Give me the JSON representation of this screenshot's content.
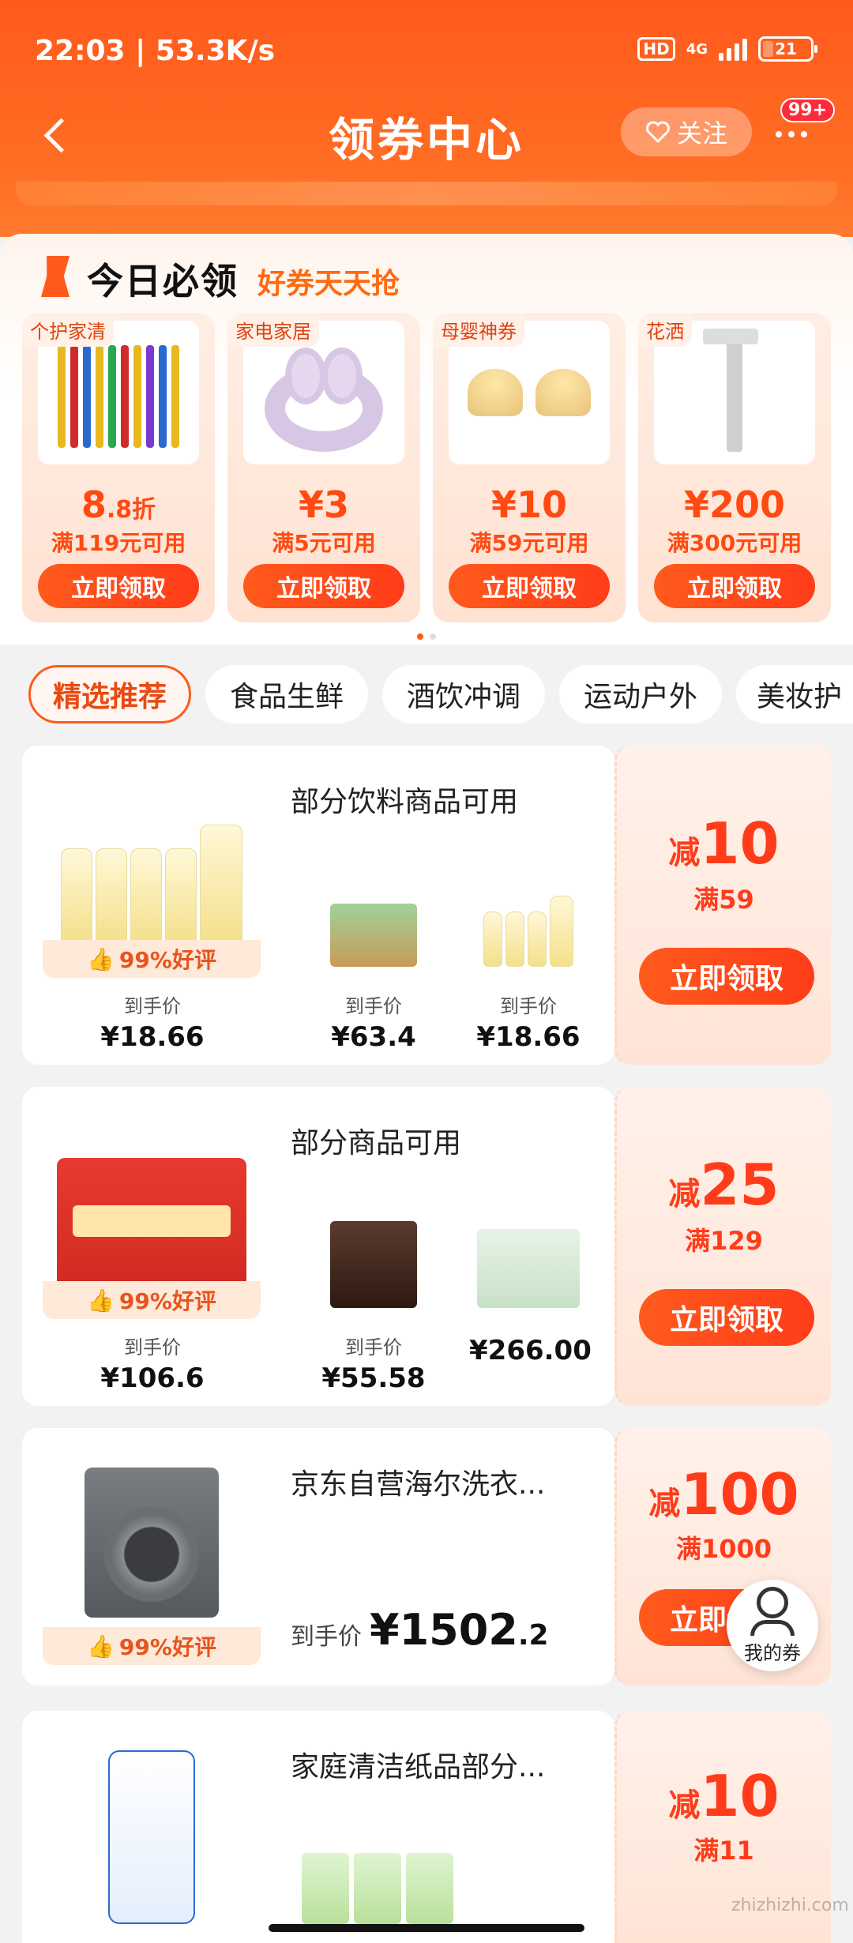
{
  "status_bar": {
    "time": "22:03 | 53.3K/s",
    "hd": "HD",
    "network": "4G",
    "battery": "21",
    "battery_level": 0.21
  },
  "header": {
    "title": "领券中心",
    "follow_label": "关注",
    "badge": "99+"
  },
  "today": {
    "title": "今日必领",
    "subtitle": "好券天天抢",
    "tiles": [
      {
        "tag": "个护家清",
        "amount_main": "8",
        "amount_small": ".8折",
        "condition": "满119元可用",
        "button": "立即领取",
        "image": "toothbrushes"
      },
      {
        "tag": "家电家居",
        "amount_main": "¥3",
        "amount_small": "",
        "condition": "满5元可用",
        "button": "立即领取",
        "image": "headband"
      },
      {
        "tag": "母婴神券",
        "amount_main": "¥10",
        "amount_small": "",
        "condition": "满59元可用",
        "button": "立即领取",
        "image": "baby-bottle-nipples"
      },
      {
        "tag": "花洒",
        "amount_main": "¥200",
        "amount_small": "",
        "condition": "满300元可用",
        "button": "立即领取",
        "image": "shower-set"
      }
    ]
  },
  "categories": [
    "精选推荐",
    "食品生鲜",
    "酒饮冲调",
    "运动户外",
    "美妆护"
  ],
  "coupons": [
    {
      "title": "部分饮料商品可用",
      "rating": "99%好评",
      "cut_label": "减",
      "cut_value": "10",
      "condition": "满59",
      "button": "立即领取",
      "items": [
        {
          "price_label": "到手价",
          "price": "¥18.66"
        },
        {
          "price_label": "到手价",
          "price": "¥63.4"
        },
        {
          "price_label": "到手价",
          "price": "¥18.66"
        }
      ]
    },
    {
      "title": "部分商品可用",
      "rating": "99%好评",
      "cut_label": "减",
      "cut_value": "25",
      "condition": "满129",
      "button": "立即领取",
      "items": [
        {
          "price_label": "到手价",
          "price": "¥106.6"
        },
        {
          "price_label": "到手价",
          "price": "¥55.58"
        },
        {
          "price_label": "",
          "price": "¥266.00"
        }
      ]
    },
    {
      "title": "京东自营海尔洗衣...",
      "rating": "99%好评",
      "cut_label": "减",
      "cut_value": "100",
      "condition": "满1000",
      "button": "立即领取",
      "price_label": "到手价",
      "price_main": "¥1502",
      "price_decimal": ".2"
    },
    {
      "title": "家庭清洁纸品部分...",
      "cut_label": "减",
      "cut_value": "10",
      "condition": "满11"
    }
  ],
  "floating": {
    "my_coupon": "我的券"
  },
  "watermark": "zhizhizhi.com",
  "colors": {
    "brand": "#ff5a1c",
    "accent_red": "#ff3c1a"
  }
}
